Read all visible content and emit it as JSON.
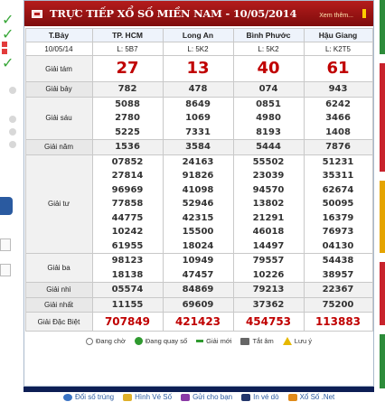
{
  "header": {
    "title": "TRỰC TIẾP XỔ SỐ MIỀN NAM - 10/05/2014",
    "more_link": "Xem thêm..."
  },
  "columns": [
    {
      "header": "T.Bảy",
      "sub": "10/05/14"
    },
    {
      "header": "TP. HCM",
      "sub": "L: 5B7"
    },
    {
      "header": "Long An",
      "sub": "L: 5K2"
    },
    {
      "header": "Bình Phước",
      "sub": "L: 5K2"
    },
    {
      "header": "Hậu Giang",
      "sub": "L: K2T5"
    }
  ],
  "prizes": [
    {
      "label": "Giải tám",
      "values": [
        [
          "27"
        ],
        [
          "13"
        ],
        [
          "40"
        ],
        [
          "61"
        ]
      ]
    },
    {
      "label": "Giải bảy",
      "values": [
        [
          "782"
        ],
        [
          "478"
        ],
        [
          "074"
        ],
        [
          "943"
        ]
      ]
    },
    {
      "label": "Giải sáu",
      "values": [
        [
          "5088",
          "2780",
          "5225"
        ],
        [
          "8649",
          "1069",
          "7331"
        ],
        [
          "0851",
          "4980",
          "8193"
        ],
        [
          "6242",
          "3466",
          "1408"
        ]
      ]
    },
    {
      "label": "Giải năm",
      "values": [
        [
          "1536"
        ],
        [
          "3584"
        ],
        [
          "5444"
        ],
        [
          "7876"
        ]
      ]
    },
    {
      "label": "Giải tư",
      "values": [
        [
          "07852",
          "27814",
          "96969",
          "77858",
          "44775",
          "10242",
          "61955"
        ],
        [
          "24163",
          "91826",
          "41098",
          "52946",
          "42315",
          "15500",
          "18024"
        ],
        [
          "55502",
          "23039",
          "94570",
          "13802",
          "21291",
          "46018",
          "14497"
        ],
        [
          "51231",
          "35311",
          "62674",
          "50095",
          "16379",
          "76973",
          "04130"
        ]
      ]
    },
    {
      "label": "Giải ba",
      "values": [
        [
          "98123",
          "18138"
        ],
        [
          "10949",
          "47457"
        ],
        [
          "79557",
          "10226"
        ],
        [
          "54438",
          "38957"
        ]
      ]
    },
    {
      "label": "Giải nhì",
      "values": [
        [
          "05574"
        ],
        [
          "84869"
        ],
        [
          "79213"
        ],
        [
          "22367"
        ]
      ]
    },
    {
      "label": "Giải nhất",
      "values": [
        [
          "11155"
        ],
        [
          "69609"
        ],
        [
          "37362"
        ],
        [
          "75200"
        ]
      ]
    },
    {
      "label": "Giải Đặc Biệt",
      "values": [
        [
          "707849"
        ],
        [
          "421423"
        ],
        [
          "454753"
        ],
        [
          "113883"
        ]
      ]
    }
  ],
  "legend": [
    {
      "icon": "clock-icon",
      "label": "Đang chờ"
    },
    {
      "icon": "spinning-icon",
      "label": "Đang quay số"
    },
    {
      "icon": "new-result-icon",
      "label": "Giải mới"
    },
    {
      "icon": "screen-icon",
      "label": "Tắt âm"
    },
    {
      "icon": "warning-icon",
      "label": "Lưu ý"
    }
  ],
  "nav": [
    {
      "icon": "globe-icon",
      "label": "Đổi số trúng"
    },
    {
      "icon": "ticket-icon",
      "label": "Hình Vé Số"
    },
    {
      "icon": "mail-icon",
      "label": "Gửi cho bạn"
    },
    {
      "icon": "print-icon",
      "label": "In vé dò"
    },
    {
      "icon": "site-icon",
      "label": "Xổ Số .Net"
    }
  ],
  "colors": {
    "header_bg": "#9b1212",
    "prize_red": "#c00000",
    "column_blue": "#1d3f8a",
    "footer_navy": "#0d1e55"
  }
}
